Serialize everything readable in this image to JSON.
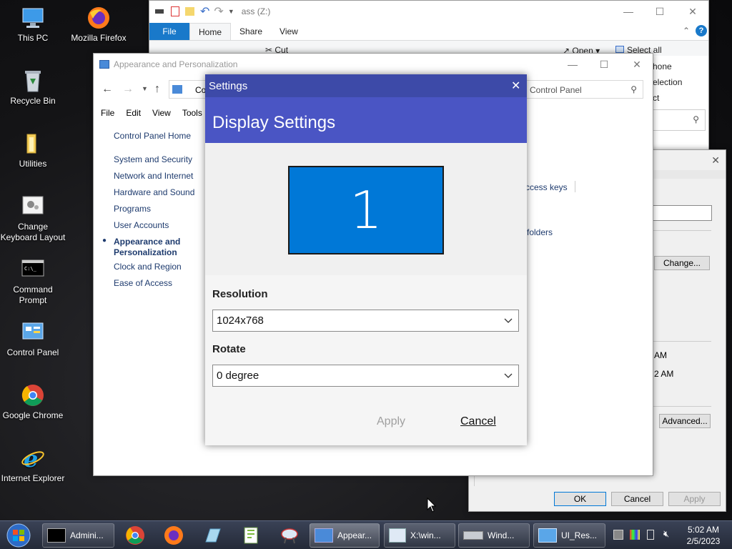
{
  "desktop": {
    "icons": [
      {
        "label": "This PC"
      },
      {
        "label": "Mozilla Firefox"
      },
      {
        "label": "Recycle Bin"
      },
      {
        "label": "Utilities"
      },
      {
        "label": "Change Keyboard Layout"
      },
      {
        "label": "Command Prompt"
      },
      {
        "label": "Control Panel"
      },
      {
        "label": "Google Chrome"
      },
      {
        "label": "Internet Explorer"
      }
    ]
  },
  "explorer": {
    "title": "ass (Z:)",
    "tabs": [
      "File",
      "Home",
      "Share",
      "View"
    ],
    "ribbon": {
      "cut": "Cut",
      "open": "Open",
      "select_all": "Select all",
      "select_none": "hone",
      "invert": "election",
      "ct": "ct"
    }
  },
  "control_panel": {
    "title": "Appearance and Personalization",
    "address": "Co",
    "search_placeholder": "h Control Panel",
    "menu": [
      "File",
      "Edit",
      "View",
      "Tools"
    ],
    "sidebar": {
      "home": "Control Panel Home",
      "items": [
        "System and Security",
        "Network and Internet",
        "Hardware and Sound",
        "Programs",
        "User Accounts",
        "Appearance and Personalization",
        "Clock and Region",
        "Ease of Access"
      ],
      "active_index": 5
    },
    "right_links": [
      "ccess keys",
      "folders"
    ]
  },
  "props_dialog": {
    "change_label": "Change...",
    "time1": "AM",
    "time2": "2 AM",
    "advanced_label": "Advanced...",
    "ok_label": "OK",
    "cancel_label": "Cancel",
    "apply_label": "Apply"
  },
  "settings": {
    "title": "Settings",
    "header": "Display Settings",
    "monitor_number": "1",
    "resolution_label": "Resolution",
    "resolution_value": "1024x768",
    "rotate_label": "Rotate",
    "rotate_value": "0 degree",
    "apply_label": "Apply",
    "cancel_label": "Cancel",
    "colors": {
      "title": "#3d4aa8",
      "header": "#4a55c4",
      "monitor": "#0078d7"
    }
  },
  "taskbar": {
    "buttons": [
      {
        "label": "Admini..."
      },
      {
        "label": "Appear..."
      },
      {
        "label": "X:\\win..."
      },
      {
        "label": "Wind..."
      },
      {
        "label": "UI_Res..."
      }
    ],
    "clock": {
      "time": "5:02 AM",
      "date": "2/5/2023"
    }
  }
}
